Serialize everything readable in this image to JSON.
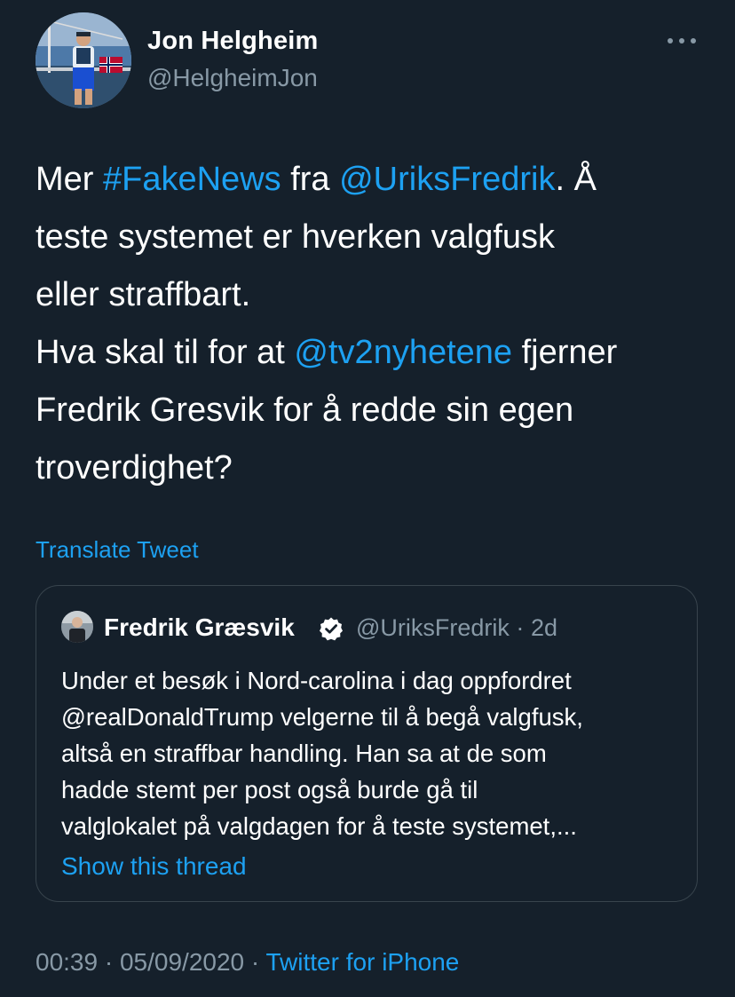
{
  "colors": {
    "background": "#15202b",
    "text": "#ffffff",
    "secondary_text": "#8899a6",
    "link": "#1da1f2",
    "border": "#38444d"
  },
  "author": {
    "name": "Jon Helgheim",
    "handle": "@HelgheimJon"
  },
  "more_icon": "more-horizontal-icon",
  "tweet": {
    "lines": [
      [
        {
          "text": "Mer ",
          "link": false
        },
        {
          "text": "#FakeNews",
          "link": true
        },
        {
          "text": " fra ",
          "link": false
        },
        {
          "text": "@UriksFredrik",
          "link": true
        },
        {
          "text": ". Å",
          "link": false
        }
      ],
      [
        {
          "text": "teste systemet er hverken valgfusk",
          "link": false
        }
      ],
      [
        {
          "text": "eller straffbart.",
          "link": false
        }
      ],
      [
        {
          "text": "Hva skal til for at ",
          "link": false
        },
        {
          "text": "@tv2nyhetene",
          "link": true
        },
        {
          "text": " fjerner",
          "link": false
        }
      ],
      [
        {
          "text": "Fredrik Gresvik for å redde sin egen",
          "link": false
        }
      ],
      [
        {
          "text": "troverdighet?",
          "link": false
        }
      ]
    ]
  },
  "translate_label": "Translate Tweet",
  "quote": {
    "name": "Fredrik Græsvik",
    "verified_icon": "verified-badge-icon",
    "handle": "@UriksFredrik",
    "separator": "·",
    "age": "2d",
    "lines": [
      "Under et besøk i Nord-carolina i dag oppfordret",
      "@realDonaldTrump velgerne til å begå valgfusk,",
      "altså en straffbar handling. Han sa at de som",
      "hadde stemt per post også burde gå til",
      "valglokalet på valgdagen for å teste systemet,..."
    ],
    "show_thread": "Show this thread"
  },
  "meta": {
    "time": "00:39",
    "separator": "·",
    "date": "05/09/2020",
    "source": "Twitter for iPhone"
  }
}
